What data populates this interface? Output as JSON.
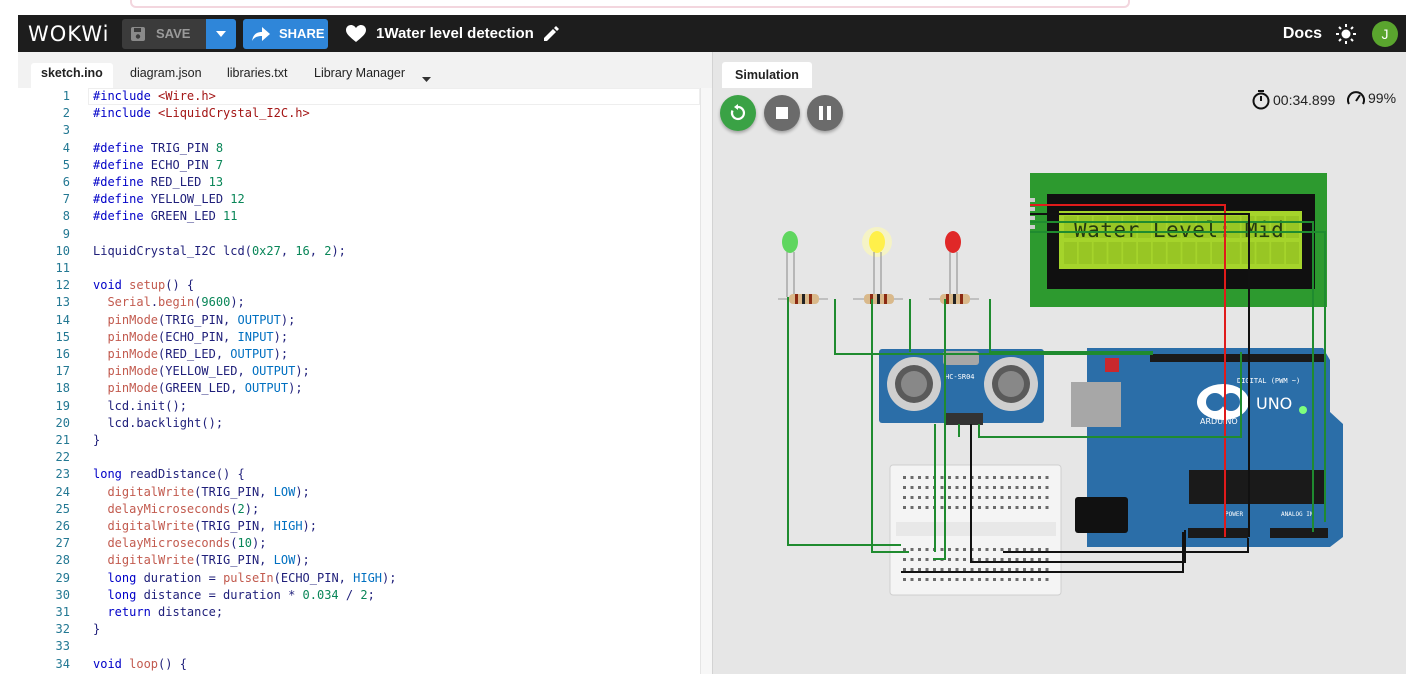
{
  "header": {
    "logo": "WOKWi",
    "save_label": "SAVE",
    "share_label": "SHARE",
    "project_title": "1Water level detection",
    "docs_label": "Docs",
    "avatar_initial": "J"
  },
  "editor": {
    "tabs": [
      "sketch.ino",
      "diagram.json",
      "libraries.txt",
      "Library Manager"
    ],
    "active_tab": "sketch.ino",
    "line_numbers": [
      "1",
      "2",
      "3",
      "4",
      "5",
      "6",
      "7",
      "8",
      "9",
      "10",
      "11",
      "12",
      "13",
      "14",
      "15",
      "16",
      "17",
      "18",
      "19",
      "20",
      "21",
      "22",
      "23",
      "24",
      "25",
      "26",
      "27",
      "28",
      "29",
      "30",
      "31",
      "32",
      "33",
      "34"
    ]
  },
  "simulation": {
    "tab_label": "Simulation",
    "timer": "00:34.899",
    "speed": "99%",
    "lcd_text": "Water Level: Mid",
    "sensor_label": "HC-SR04",
    "board_label": "UNO",
    "board_brand": "ARDUINO",
    "digital_label": "DIGITAL (PWM ~)",
    "analog_label": "ANALOG IN",
    "power_label": "POWER"
  },
  "colors": {
    "header_bg": "#1d1d1d",
    "share_blue": "#2f86d9",
    "restart_green": "#3aa245",
    "stop_grey": "#6b6b6b",
    "board_blue": "#2b6ea8",
    "lcd_green": "#2d9a2f",
    "lcd_screen": "#a5d42b",
    "wire_green": "#1f8b2f",
    "wire_red": "#e01b1b"
  },
  "icons": [
    "save-icon",
    "chevron-down-icon",
    "share-arrow-icon",
    "heart-icon",
    "pencil-icon",
    "sun-icon",
    "restart-icon",
    "stop-icon",
    "pause-icon",
    "stopwatch-icon",
    "speedometer-icon"
  ]
}
